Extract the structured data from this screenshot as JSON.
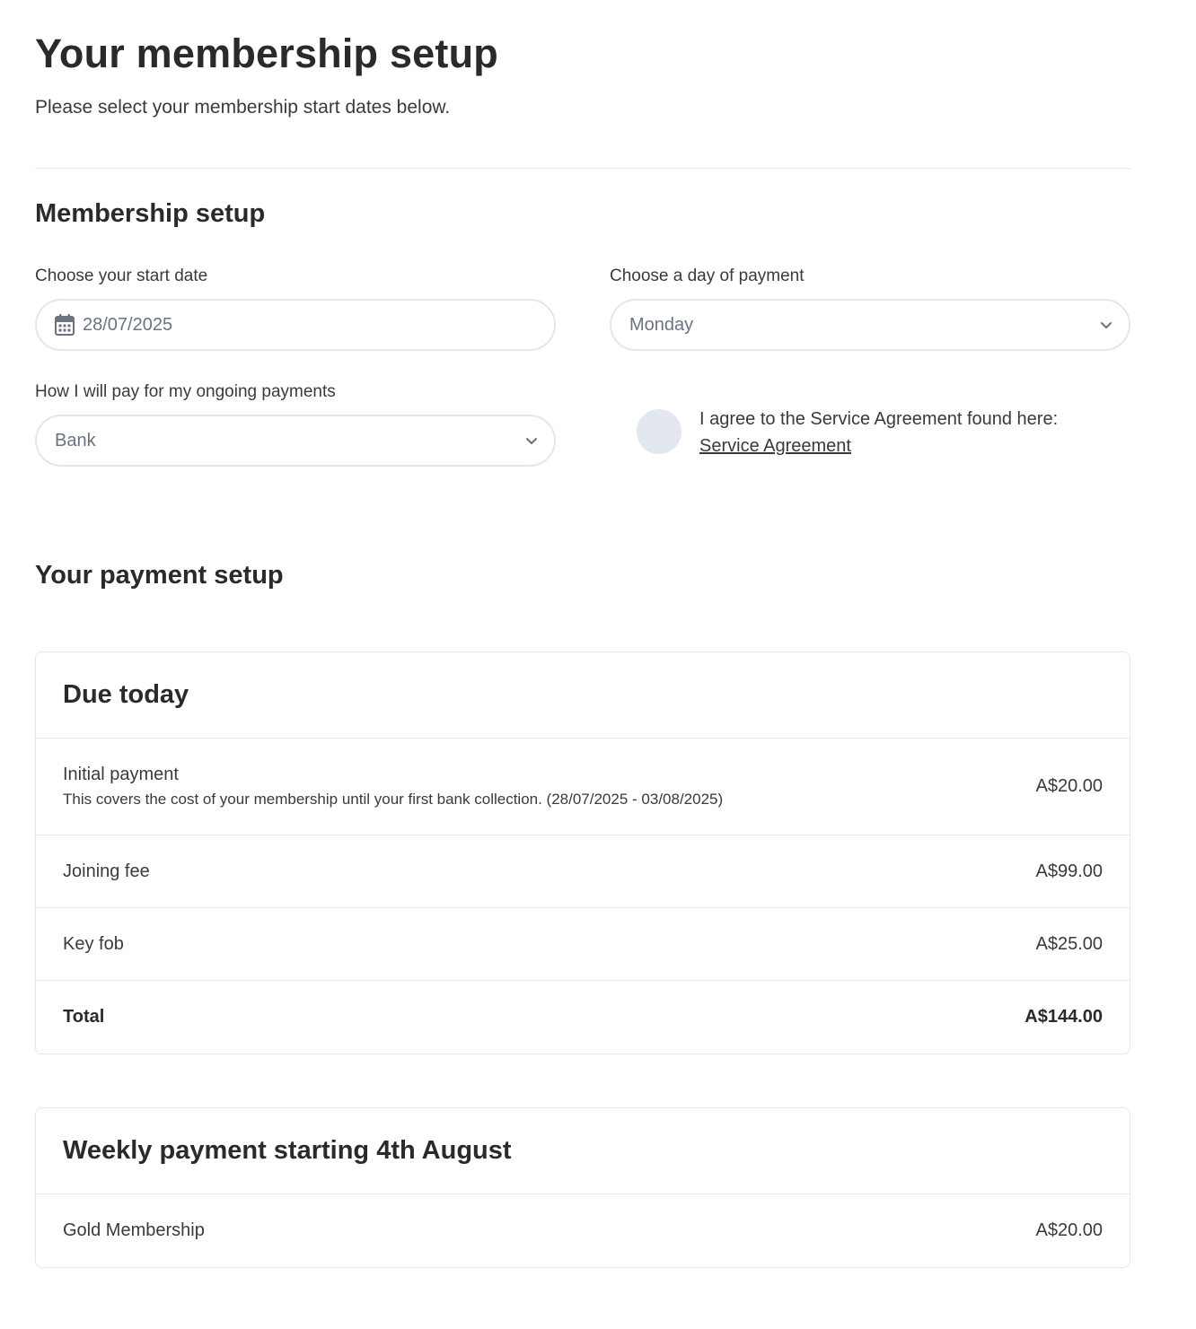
{
  "header": {
    "title": "Your membership setup",
    "subtitle": "Please select your membership start dates below."
  },
  "membership_setup": {
    "section_title": "Membership setup",
    "start_date": {
      "label": "Choose your start date",
      "value": "28/07/2025",
      "icon": "calendar-icon"
    },
    "payment_day": {
      "label": "Choose a day of payment",
      "value": "Monday",
      "icon": "chevron-down-icon"
    },
    "payment_method": {
      "label": "How I will pay for my ongoing payments",
      "value": "Bank",
      "icon": "chevron-down-icon"
    },
    "agreement": {
      "text": "I agree to the Service Agreement found here:",
      "link_text": "Service Agreement",
      "checked": false
    }
  },
  "payment_setup": {
    "section_title": "Your payment setup",
    "due_today": {
      "title": "Due today",
      "items": [
        {
          "label": "Initial payment",
          "description": "This covers the cost of your membership until your first bank collection. (28/07/2025 - 03/08/2025)",
          "amount": "A$20.00"
        },
        {
          "label": "Joining fee",
          "amount": "A$99.00"
        },
        {
          "label": "Key fob",
          "amount": "A$25.00"
        }
      ],
      "total": {
        "label": "Total",
        "amount": "A$144.00"
      }
    },
    "weekly": {
      "title": "Weekly payment starting 4th August",
      "items": [
        {
          "label": "Gold Membership",
          "amount": "A$20.00"
        }
      ]
    }
  },
  "colors": {
    "text": "#2a2a2a",
    "muted": "#6b7280",
    "border": "#e6e6e6",
    "toggle": "#e2e7f0",
    "background": "#ffffff"
  }
}
